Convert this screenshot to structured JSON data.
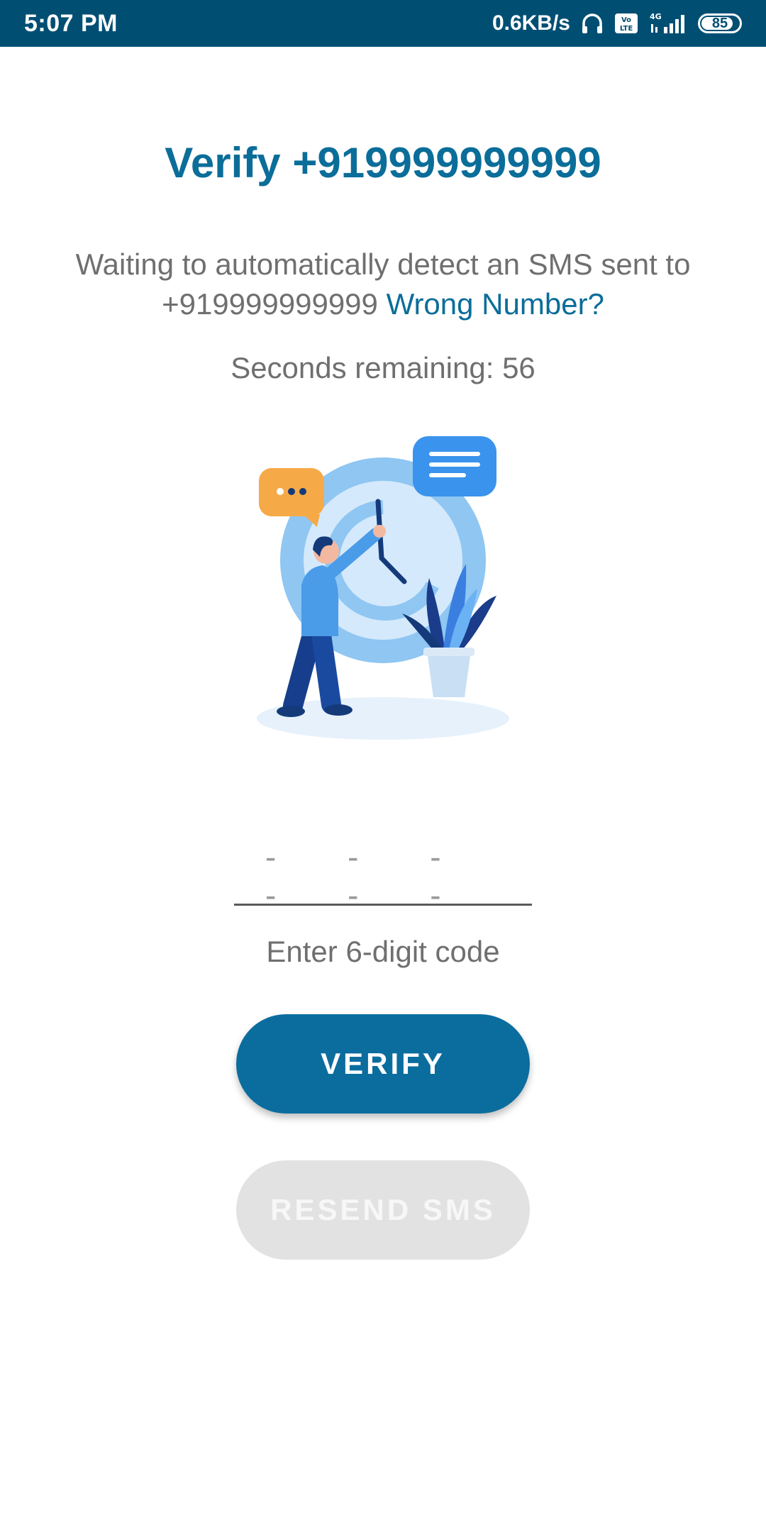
{
  "status_bar": {
    "time": "5:07 PM",
    "network_speed": "0.6KB/s",
    "headphone_icon": "headphone-icon",
    "volte_icon": "volte-icon",
    "network_type": "4G",
    "signal_icon": "signal-icon",
    "battery_level": "85"
  },
  "header": {
    "title": "Verify +919999999999"
  },
  "message": {
    "text": "Waiting to automatically detect an SMS sent to +919999999999",
    "link": "Wrong Number?"
  },
  "timer": {
    "text": "Seconds remaining: 56"
  },
  "code_input": {
    "placeholder": "- - - - - -",
    "hint": "Enter 6-digit code"
  },
  "buttons": {
    "verify_label": "VERIFY",
    "resend_label": "RESEND SMS"
  },
  "colors": {
    "status_bar": "#004f73",
    "accent": "#0b6d99",
    "muted_text": "#6f6f6f",
    "disabled_button": "#e2e2e2"
  }
}
